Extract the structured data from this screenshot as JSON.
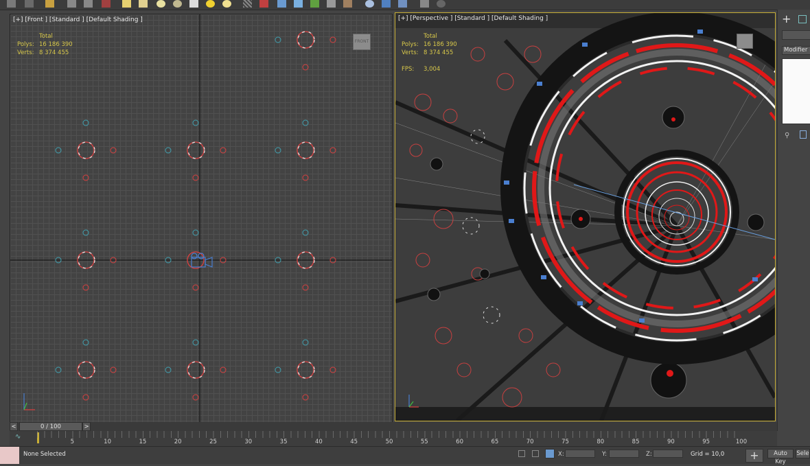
{
  "viewports": {
    "front": {
      "label": "[+] [Front ] [Standard ] [Default Shading ]",
      "stats_total": "Total",
      "polys_label": "Polys:",
      "polys_value": "16 186 390",
      "verts_label": "Verts:",
      "verts_value": "8 374 455",
      "viewcube_label": "FRONT"
    },
    "perspective": {
      "label": "[+] [Perspective ] [Standard ] [Default Shading ]",
      "stats_total": "Total",
      "polys_label": "Polys:",
      "polys_value": "16 186 390",
      "verts_label": "Verts:",
      "verts_value": "8 374 455",
      "fps_label": "FPS:",
      "fps_value": "3,004"
    }
  },
  "command_panel": {
    "modifier_list": "Modifier List"
  },
  "timeline": {
    "frame_display": "0 / 100",
    "prev": "<",
    "next": ">",
    "ticks": [
      "5",
      "10",
      "15",
      "20",
      "25",
      "30",
      "35",
      "40",
      "45",
      "50",
      "55",
      "60",
      "65",
      "70",
      "75",
      "80",
      "85",
      "90",
      "95",
      "100"
    ]
  },
  "status_bar": {
    "selection": "None Selected",
    "x_label": "X:",
    "y_label": "Y:",
    "z_label": "Z:",
    "grid": "Grid = 10,0",
    "auto_key": "Auto Key",
    "set_key": "Sele"
  },
  "colors": {
    "accent_yellow": "#c9b036",
    "stats_text": "#d8c84a",
    "red_ring": "#e01818",
    "white_ring": "#f2f2f2",
    "blue_marker": "#4a7fd0"
  }
}
